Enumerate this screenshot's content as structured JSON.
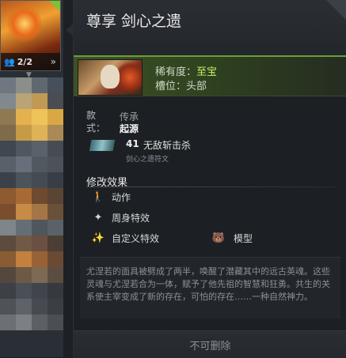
{
  "hero_card": {
    "count": "2/2",
    "people_icon": "people-icon",
    "arrow_icon": "double-chevron-right-icon",
    "accent_color": "#7cc13a"
  },
  "item": {
    "title": "尊享 剑心之遗",
    "rarity_label": "稀有度：",
    "rarity_value": "至宝",
    "rarity_color": "#c9f26a",
    "slot_label": "槽位：",
    "slot_value": "头部"
  },
  "style": {
    "label": "款式：",
    "options": [
      "传承",
      "起源"
    ],
    "selected": "起源"
  },
  "gem": {
    "count": "41",
    "name": "无敌斩击杀",
    "subtitle": "剑心之遗符文",
    "icon": "gem-icon"
  },
  "modifiers": {
    "title": "修改效果",
    "items": [
      {
        "label": "动作",
        "icon": "running-figure-icon"
      },
      {
        "label": "周身特效",
        "icon": "sparkle-icon"
      },
      {
        "label": "自定义特效",
        "icon": "magic-wand-icon"
      },
      {
        "label": "模型",
        "icon": "bear-icon"
      }
    ]
  },
  "lore": "尤涅若的面具被劈成了两半，唤醒了潜藏其中的远古英魂。这些灵魂与尤涅若合为一体，赋予了他先祖的智慧和狂勇。共生的关系使主宰变成了新的存在，可怕的存在……一种自然神力。",
  "footer": {
    "label": "不可删除"
  }
}
